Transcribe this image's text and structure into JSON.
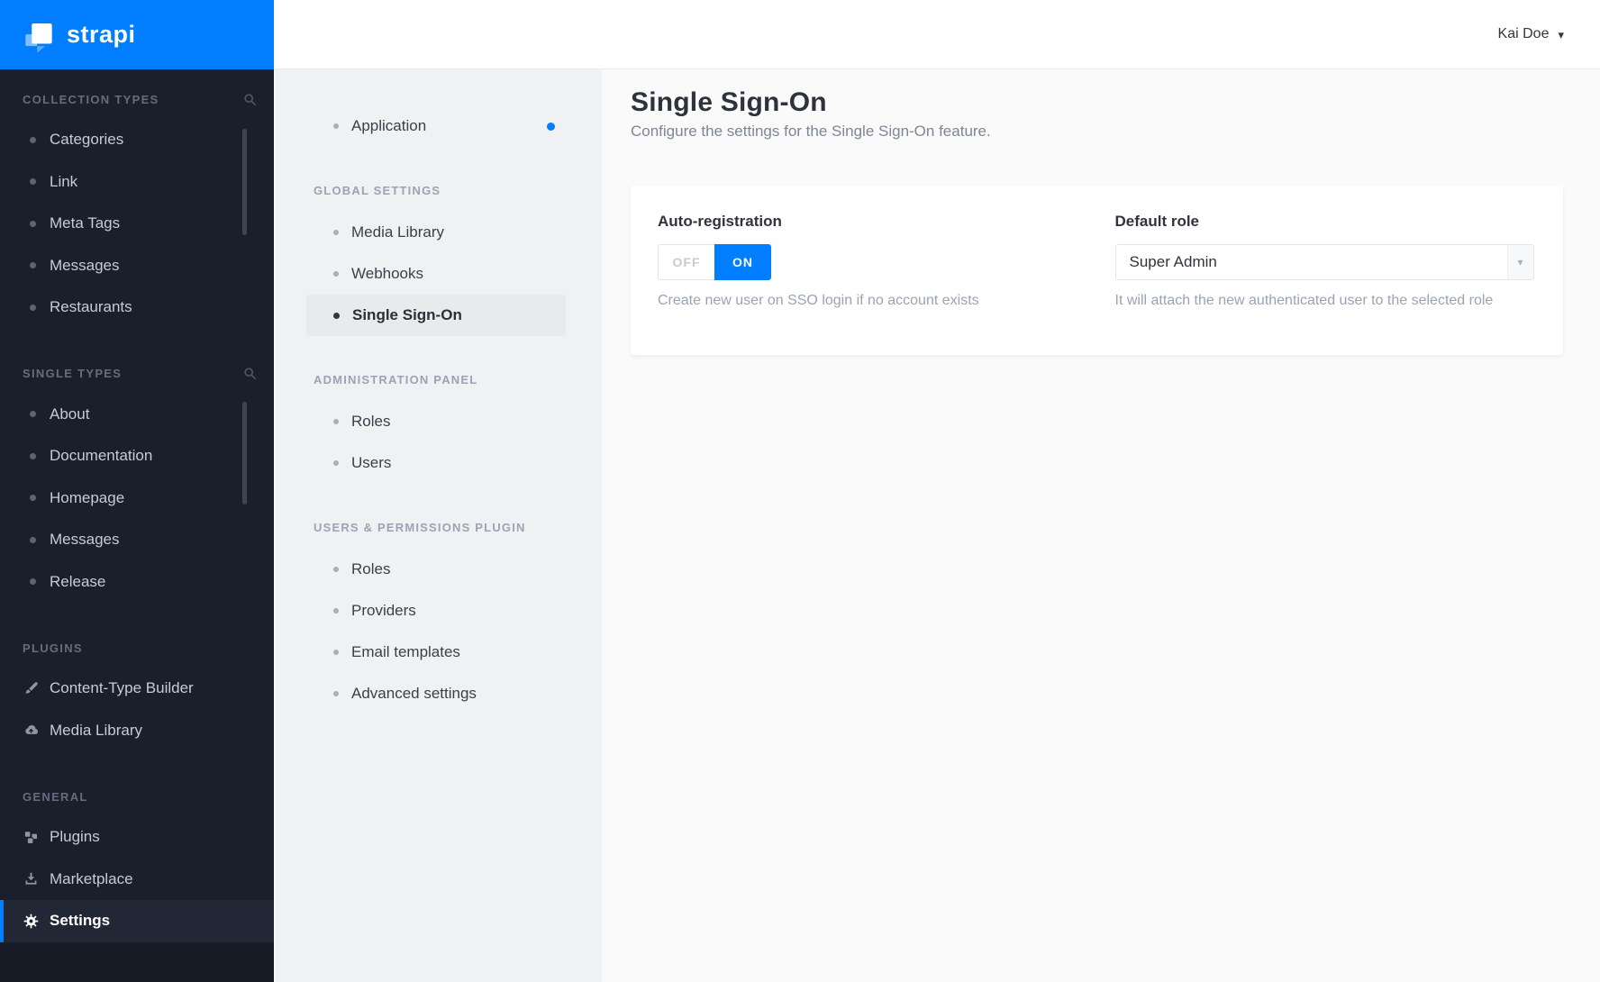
{
  "brand": {
    "name": "strapi"
  },
  "header": {
    "user_name": "Kai Doe"
  },
  "icons": {
    "caret_down": "▾"
  },
  "colors": {
    "primary": "#007eff",
    "sidebar_bg": "#1a1f2b",
    "panel_bg": "#f0f1f3",
    "main_bg": "#fafafb"
  },
  "sidebar": {
    "sections": [
      {
        "title": "COLLECTION TYPES",
        "has_search": true,
        "items": [
          {
            "label": "Categories"
          },
          {
            "label": "Link"
          },
          {
            "label": "Meta Tags"
          },
          {
            "label": "Messages"
          },
          {
            "label": "Restaurants"
          }
        ]
      },
      {
        "title": "SINGLE TYPES",
        "has_search": true,
        "items": [
          {
            "label": "About"
          },
          {
            "label": "Documentation"
          },
          {
            "label": "Homepage"
          },
          {
            "label": "Messages"
          },
          {
            "label": "Release"
          }
        ]
      },
      {
        "title": "PLUGINS",
        "has_search": false,
        "items": [
          {
            "label": "Content-Type Builder",
            "icon": "brush-icon"
          },
          {
            "label": "Media Library",
            "icon": "cloud-upload-icon"
          }
        ]
      },
      {
        "title": "GENERAL",
        "has_search": false,
        "items": [
          {
            "label": "Plugins",
            "icon": "cubes-icon"
          },
          {
            "label": "Marketplace",
            "icon": "download-tray-icon"
          },
          {
            "label": "Settings",
            "icon": "gear-icon",
            "active": true
          }
        ]
      }
    ]
  },
  "subnav": {
    "sections": [
      {
        "title": "",
        "items": [
          {
            "label": "Application",
            "notification_dot": true
          }
        ]
      },
      {
        "title": "GLOBAL SETTINGS",
        "items": [
          {
            "label": "Media Library"
          },
          {
            "label": "Webhooks"
          },
          {
            "label": "Single Sign-On",
            "active": true
          }
        ]
      },
      {
        "title": "ADMINISTRATION PANEL",
        "items": [
          {
            "label": "Roles"
          },
          {
            "label": "Users"
          }
        ]
      },
      {
        "title": "USERS & PERMISSIONS PLUGIN",
        "items": [
          {
            "label": "Roles"
          },
          {
            "label": "Providers"
          },
          {
            "label": "Email templates"
          },
          {
            "label": "Advanced settings"
          }
        ]
      }
    ]
  },
  "main": {
    "title": "Single Sign-On",
    "subtitle": "Configure the settings for the Single Sign-On feature.",
    "form": {
      "auto_registration": {
        "label": "Auto-registration",
        "off_label": "OFF",
        "on_label": "ON",
        "value": "ON",
        "description": "Create new user on SSO login if no account exists"
      },
      "default_role": {
        "label": "Default role",
        "value": "Super Admin",
        "description": "It will attach the new authenticated user to the selected role"
      }
    }
  }
}
